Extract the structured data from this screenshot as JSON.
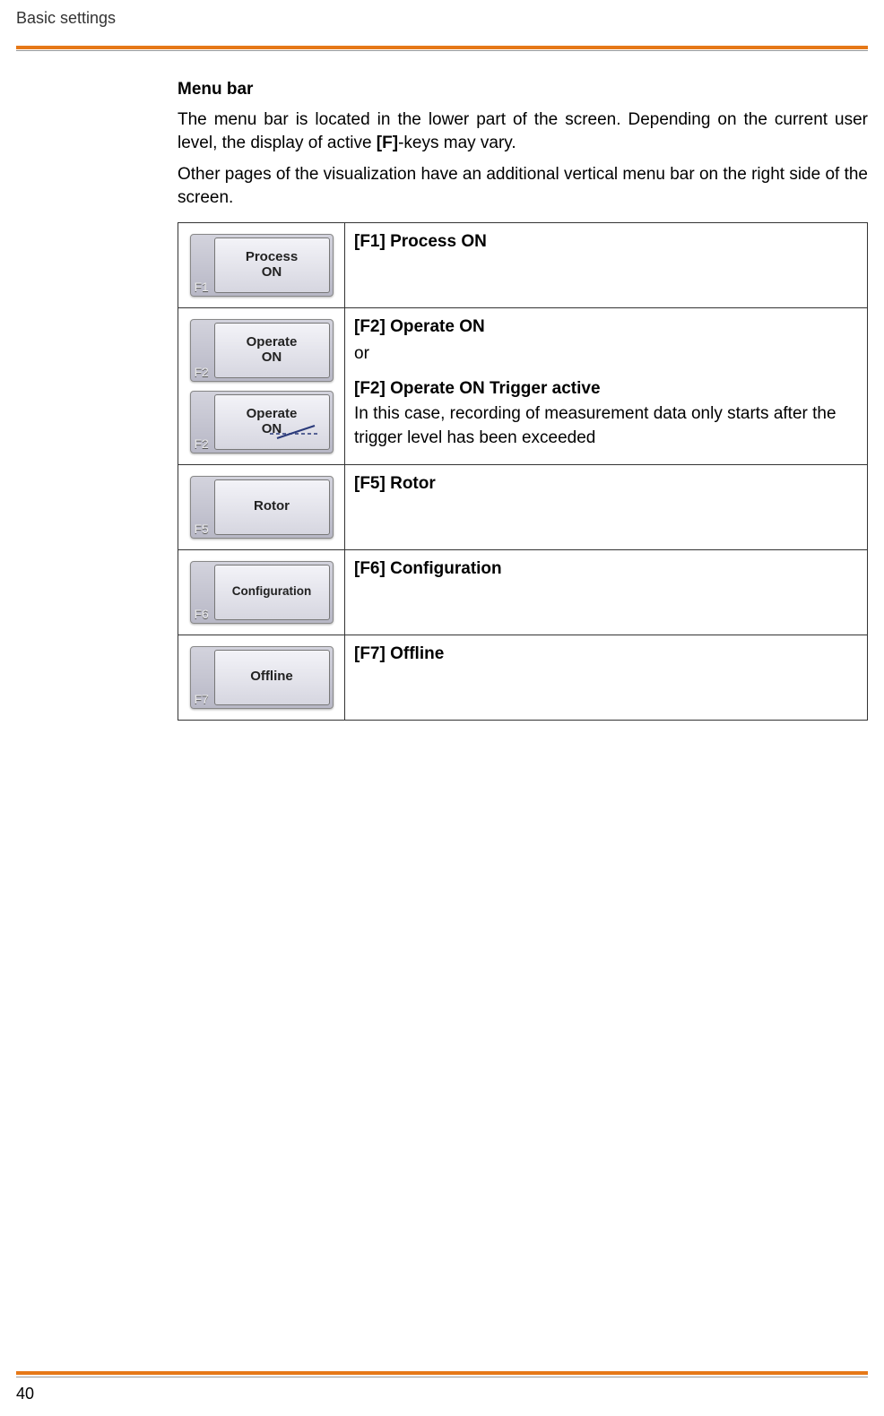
{
  "header": "Basic settings",
  "section_title": "Menu bar",
  "para1_pre": "The menu bar is located in the lower part of the screen. Depending on the current user level, the display of active ",
  "para1_bold": "[F]",
  "para1_post": "-keys may vary.",
  "para2": "Other pages of the visualization have an additional vertical menu bar on the right side of the screen.",
  "rows": [
    {
      "fkey": "F1",
      "btn_line1": "Process",
      "btn_line2": "ON",
      "desc_title": "[F1] Process ON"
    },
    {
      "fkey": "F2",
      "btn_line1": "Operate",
      "btn_line2": "ON",
      "fkey_b": "F2",
      "btn_b_line1": "Operate",
      "btn_b_line2": "ON",
      "desc_title": "[F2] Operate ON",
      "desc_or": "or",
      "desc_sub_title": "[F2] Operate ON Trigger active",
      "desc_body": "In this case, recording of measurement data only starts after the trigger level has been exceeded"
    },
    {
      "fkey": "F5",
      "btn_line1": "Rotor",
      "desc_title": "[F5] Rotor"
    },
    {
      "fkey": "F6",
      "btn_line1": "Configuration",
      "desc_title": "[F6] Configuration"
    },
    {
      "fkey": "F7",
      "btn_line1": "Offline",
      "desc_title": "[F7] Offline"
    }
  ],
  "page_number": "40"
}
